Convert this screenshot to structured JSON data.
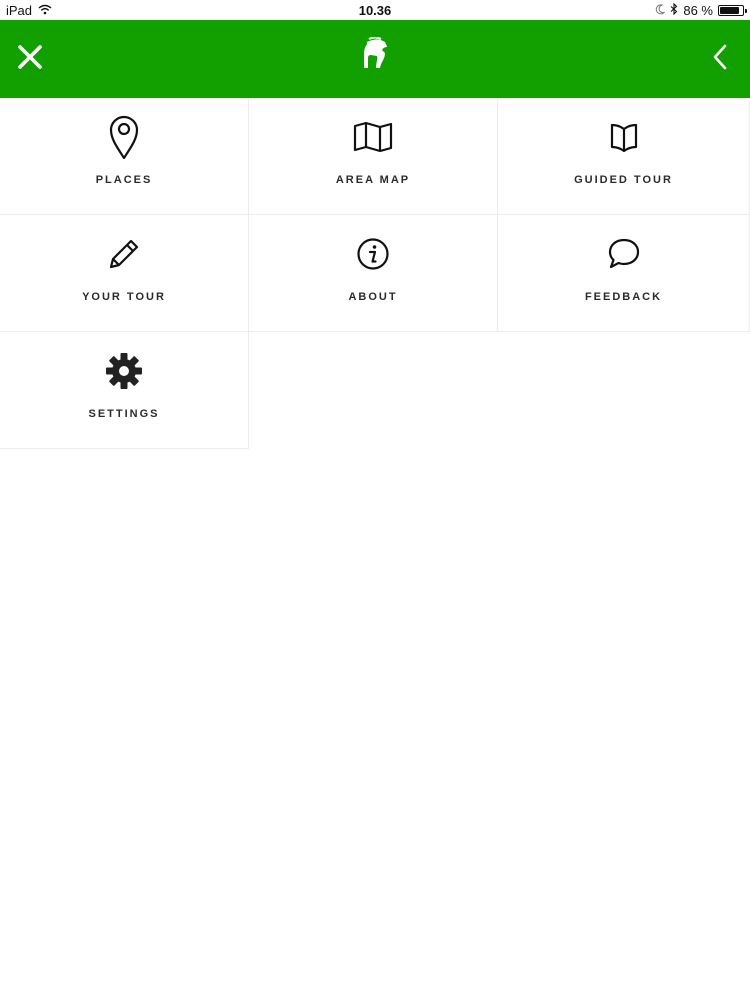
{
  "status_bar": {
    "device": "iPad",
    "time": "10.36",
    "battery_text": "86 %",
    "battery_level": 0.86
  },
  "header": {
    "background_color": "#12a000",
    "icons": {
      "close": "close-icon",
      "logo": "spartan-helmet-logo",
      "back": "chevron-left-icon"
    }
  },
  "menu": {
    "items": [
      {
        "label": "PLACES",
        "icon": "map-pin-icon"
      },
      {
        "label": "AREA MAP",
        "icon": "folded-map-icon"
      },
      {
        "label": "GUIDED TOUR",
        "icon": "open-book-icon"
      },
      {
        "label": "YOUR TOUR",
        "icon": "pencil-icon"
      },
      {
        "label": "ABOUT",
        "icon": "info-icon"
      },
      {
        "label": "FEEDBACK",
        "icon": "speech-bubble-icon"
      },
      {
        "label": "SETTINGS",
        "icon": "gear-icon"
      }
    ]
  }
}
